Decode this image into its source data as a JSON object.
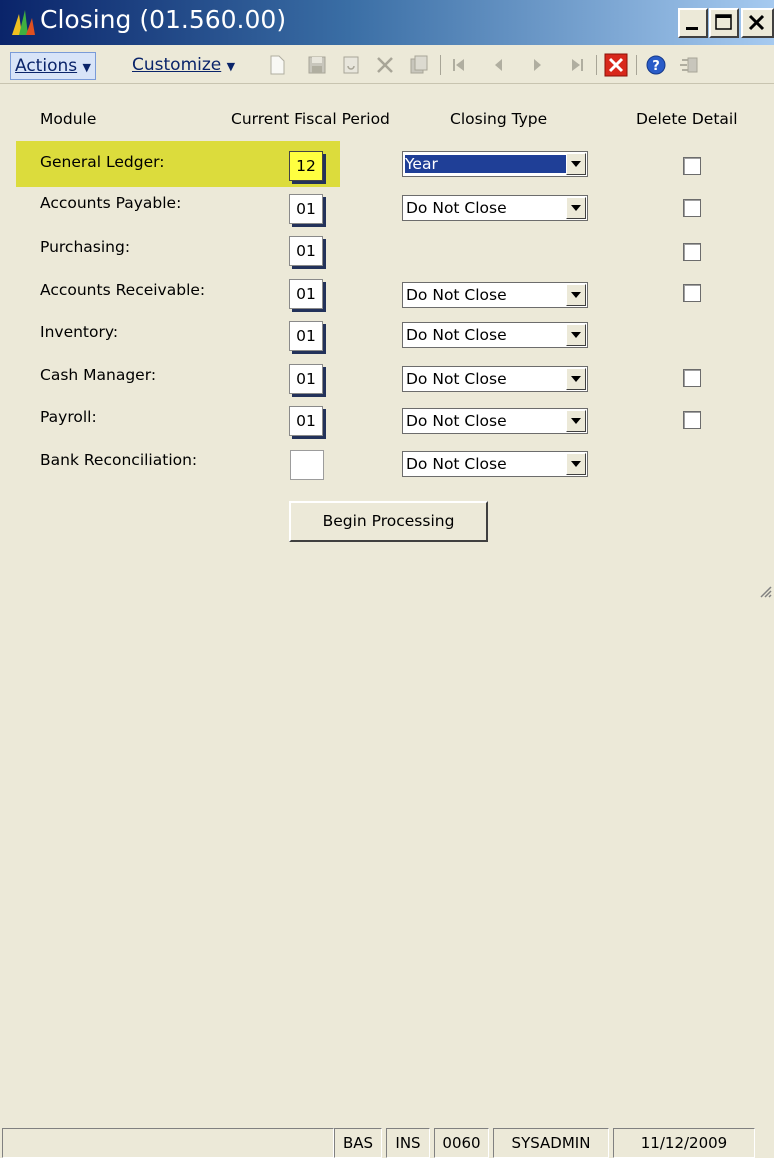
{
  "window": {
    "title": "Closing (01.560.00)"
  },
  "toolbar": {
    "actions_label": "Actions",
    "customize_label": "Customize"
  },
  "columns": {
    "module": "Module",
    "period": "Current Fiscal Period",
    "closing_type": "Closing Type",
    "delete_detail": "Delete Detail"
  },
  "rows": [
    {
      "module": "General Ledger:",
      "period": "12",
      "closing_type": "Year"
    },
    {
      "module": "Accounts Payable:",
      "period": "01",
      "closing_type": "Do Not Close"
    },
    {
      "module": "Purchasing:",
      "period": "01",
      "closing_type": ""
    },
    {
      "module": "Accounts Receivable:",
      "period": "01",
      "closing_type": "Do Not Close"
    },
    {
      "module": "Inventory:",
      "period": "01",
      "closing_type": "Do Not Close"
    },
    {
      "module": "Cash Manager:",
      "period": "01",
      "closing_type": "Do Not Close"
    },
    {
      "module": "Payroll:",
      "period": "01",
      "closing_type": "Do Not Close"
    },
    {
      "module": "Bank Reconciliation:",
      "period": "",
      "closing_type": "Do Not Close"
    }
  ],
  "begin_button": {
    "label": "Begin Processing"
  },
  "status": {
    "mode": "BAS",
    "insert": "INS",
    "company": "0060",
    "user": "SYSADMIN",
    "date": "11/12/2009"
  },
  "colors": {
    "highlight": "#dcdc3c",
    "selection": "#1f3f97",
    "titlebar": "#0a246a"
  }
}
